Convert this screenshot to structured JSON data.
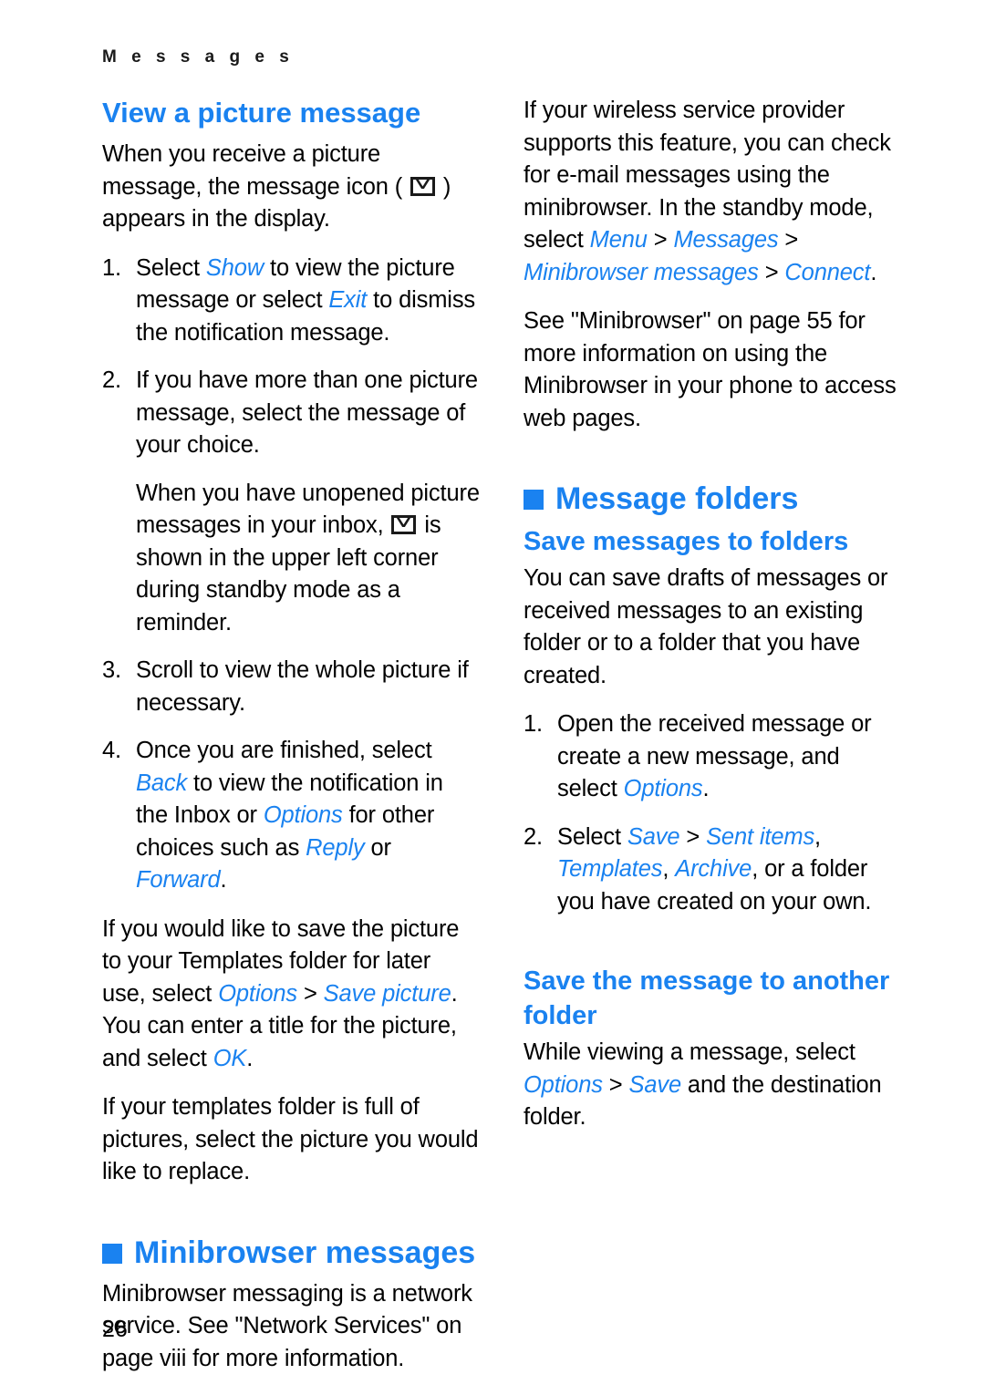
{
  "page": {
    "running_head": "M e s s a g e s",
    "folio": "26",
    "accent_color": "#1a82f0",
    "text_color": "#000000"
  },
  "left_column": {
    "heading": "View a picture message",
    "intro": {
      "before_icon": "When you receive a picture message, the message icon ( ",
      "icon": "envelope-icon",
      "after_icon": " ) appears in the display."
    },
    "steps": [
      {
        "num": "1.",
        "parts": [
          {
            "t": "Select ",
            "style": "plain"
          },
          {
            "t": "Show",
            "style": "ui"
          },
          {
            "t": " to view the picture message or select ",
            "style": "plain"
          },
          {
            "t": "Exit",
            "style": "ui"
          },
          {
            "t": " to dismiss the notification message.",
            "style": "plain"
          }
        ]
      },
      {
        "num": "2.",
        "parts": [
          {
            "t": "If you have more than one picture message, select the message of your choice.",
            "style": "plain"
          }
        ],
        "sub_before_icon": "When you have unopened picture messages in your inbox, ",
        "sub_icon": "envelope-icon",
        "sub_after_icon": " is shown in the upper left corner during standby mode as a reminder."
      },
      {
        "num": "3.",
        "parts": [
          {
            "t": "Scroll to view the whole picture if necessary.",
            "style": "plain"
          }
        ]
      },
      {
        "num": "4.",
        "parts": [
          {
            "t": "Once you are finished, select ",
            "style": "plain"
          },
          {
            "t": "Back",
            "style": "ui"
          },
          {
            "t": " to view the notification in the Inbox or ",
            "style": "plain"
          },
          {
            "t": "Options",
            "style": "ui"
          },
          {
            "t": " for other choices such as ",
            "style": "plain"
          },
          {
            "t": "Reply",
            "style": "ui"
          },
          {
            "t": " or ",
            "style": "plain"
          },
          {
            "t": "Forward",
            "style": "ui"
          },
          {
            "t": ".",
            "style": "plain"
          }
        ]
      }
    ],
    "para_save_picture": [
      {
        "t": "If you would like to save the picture to your Templates folder for later use, select ",
        "style": "plain"
      },
      {
        "t": "Options",
        "style": "ui"
      },
      {
        "t": " > ",
        "style": "sep"
      },
      {
        "t": "Save picture",
        "style": "ui"
      },
      {
        "t": ". You can enter a title for the picture, and select ",
        "style": "plain"
      },
      {
        "t": "OK",
        "style": "ui"
      },
      {
        "t": ".",
        "style": "plain"
      }
    ],
    "para_templates_full": "If your templates folder is full of pictures, select the picture you would like to replace.",
    "heading_minibrowser": "Minibrowser messages",
    "para_minibrowser": "Minibrowser messaging is a network service. See \"Network Services\" on page viii for more information."
  },
  "right_column": {
    "para_provider": [
      {
        "t": "If your wireless service provider supports this feature, you can check for e-mail messages using the minibrowser. In the standby mode, select ",
        "style": "plain"
      },
      {
        "t": "Menu",
        "style": "ui"
      },
      {
        "t": " > ",
        "style": "sep"
      },
      {
        "t": "Messages",
        "style": "ui"
      },
      {
        "t": " > ",
        "style": "sep"
      },
      {
        "t": "Minibrowser messages",
        "style": "ui"
      },
      {
        "t": " > ",
        "style": "sep"
      },
      {
        "t": "Connect",
        "style": "ui"
      },
      {
        "t": ".",
        "style": "plain"
      }
    ],
    "para_see_minibrowser": "See \"Minibrowser\" on page 55 for more information on using the Minibrowser in your phone to access web pages.",
    "heading_message_folders": "Message folders",
    "heading_save_messages": "Save messages to folders",
    "para_save_drafts": "You can save drafts of messages or received messages to an existing folder or to a folder that you have created.",
    "steps": [
      {
        "num": "1.",
        "parts": [
          {
            "t": "Open the received message or create a new message, and select ",
            "style": "plain"
          },
          {
            "t": "Options",
            "style": "ui"
          },
          {
            "t": ".",
            "style": "plain"
          }
        ]
      },
      {
        "num": "2.",
        "parts": [
          {
            "t": "Select ",
            "style": "plain"
          },
          {
            "t": "Save",
            "style": "ui"
          },
          {
            "t": " > ",
            "style": "sep"
          },
          {
            "t": "Sent items",
            "style": "ui"
          },
          {
            "t": ", ",
            "style": "plain"
          },
          {
            "t": "Templates",
            "style": "ui"
          },
          {
            "t": ", ",
            "style": "plain"
          },
          {
            "t": "Archive",
            "style": "ui"
          },
          {
            "t": ", or a folder you have created on your own.",
            "style": "plain"
          }
        ]
      }
    ],
    "heading_save_another": "Save the message to another folder",
    "para_while_viewing": [
      {
        "t": "While viewing a message, select ",
        "style": "plain"
      },
      {
        "t": "Options",
        "style": "ui"
      },
      {
        "t": " > ",
        "style": "sep"
      },
      {
        "t": "Save",
        "style": "ui"
      },
      {
        "t": " and the destination folder.",
        "style": "plain"
      }
    ]
  }
}
